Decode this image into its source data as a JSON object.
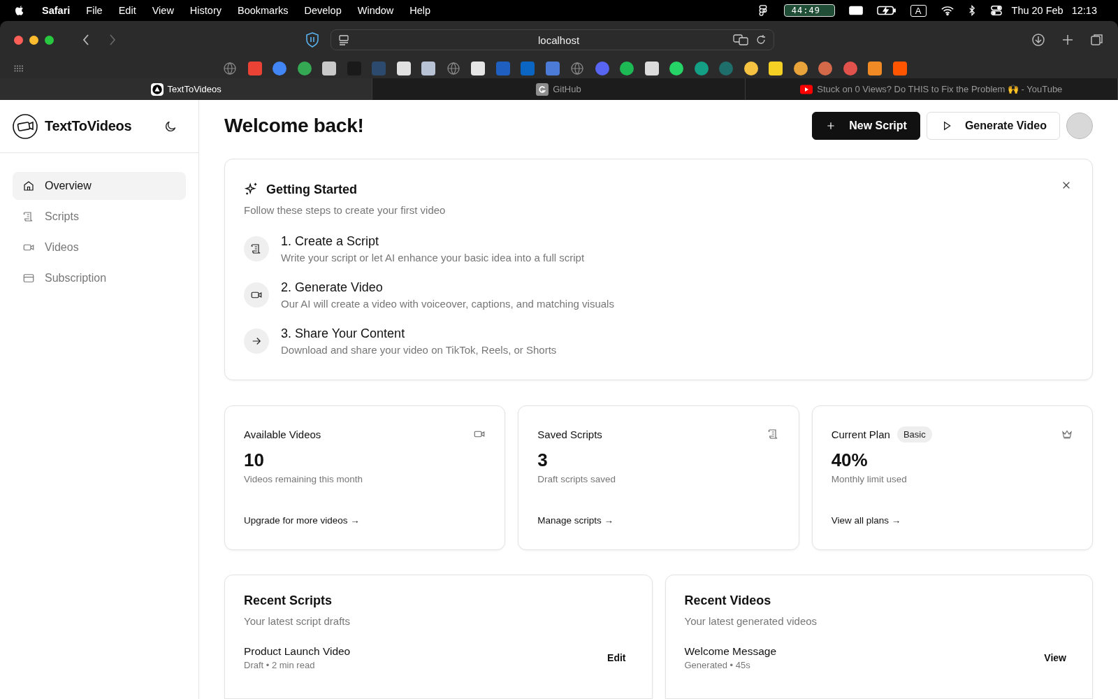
{
  "menu_bar": {
    "app": "Safari",
    "items": [
      "File",
      "Edit",
      "View",
      "History",
      "Bookmarks",
      "Develop",
      "Window",
      "Help"
    ],
    "timer": "44:49",
    "input_source": "A",
    "date": "Thu 20 Feb",
    "time": "12:13"
  },
  "browser": {
    "address": "localhost",
    "bookmarks": [
      {
        "kind": "globe",
        "color": "#8a8a8a"
      },
      {
        "kind": "tile",
        "color": "#ea4335"
      },
      {
        "kind": "round",
        "color": "#4285f4"
      },
      {
        "kind": "round",
        "color": "#34a853"
      },
      {
        "kind": "tile",
        "color": "#c9c9c9"
      },
      {
        "kind": "tile",
        "color": "#1a1a1a"
      },
      {
        "kind": "tile",
        "color": "#2c4a6e"
      },
      {
        "kind": "tile",
        "color": "#e0e0e0"
      },
      {
        "kind": "tile",
        "color": "#b9c3d6"
      },
      {
        "kind": "globe",
        "color": "#8a8a8a"
      },
      {
        "kind": "tile",
        "color": "#e6e6e6"
      },
      {
        "kind": "tile",
        "color": "#1f5fbf"
      },
      {
        "kind": "tile",
        "color": "#0a66c2"
      },
      {
        "kind": "tile",
        "color": "#4b7bd6"
      },
      {
        "kind": "globe",
        "color": "#8a8a8a"
      },
      {
        "kind": "round",
        "color": "#5865f2"
      },
      {
        "kind": "round",
        "color": "#1db954"
      },
      {
        "kind": "tile",
        "color": "#dcdcdc"
      },
      {
        "kind": "round",
        "color": "#25d366"
      },
      {
        "kind": "round",
        "color": "#14a085"
      },
      {
        "kind": "round",
        "color": "#1e6f6b"
      },
      {
        "kind": "round",
        "color": "#f5c242"
      },
      {
        "kind": "tile",
        "color": "#f5d024"
      },
      {
        "kind": "round",
        "color": "#e8a33b"
      },
      {
        "kind": "round",
        "color": "#d4694a"
      },
      {
        "kind": "round",
        "color": "#e0524b"
      },
      {
        "kind": "tile",
        "color": "#f08a24"
      },
      {
        "kind": "tile",
        "color": "#ff5500"
      }
    ],
    "tabs": [
      {
        "title": "TextToVideos",
        "selected": true,
        "kind": "app"
      },
      {
        "title": "GitHub",
        "selected": false,
        "kind": "letter"
      },
      {
        "title": "Stuck on 0 Views? Do THIS to Fix the Problem 🙌 - YouTube",
        "selected": false,
        "kind": "video"
      }
    ]
  },
  "sidebar": {
    "brand": "TextToVideos",
    "items": [
      {
        "label": "Overview",
        "kind": "home",
        "selected": true
      },
      {
        "label": "Scripts",
        "kind": "scroll",
        "selected": false
      },
      {
        "label": "Videos",
        "kind": "video",
        "selected": false
      },
      {
        "label": "Subscription",
        "kind": "card",
        "selected": false
      }
    ]
  },
  "header": {
    "title": "Welcome back!",
    "buttons": [
      {
        "label": "New Script",
        "kind": "primary"
      },
      {
        "label": "Generate Video",
        "kind": "outline"
      }
    ]
  },
  "getting_started": {
    "title": "Getting Started",
    "subtitle": "Follow these steps to create your first video",
    "steps": [
      {
        "title": "1. Create a Script",
        "description": "Write your script or let AI enhance your basic idea into a full script",
        "kind": "scroll"
      },
      {
        "title": "2. Generate Video",
        "description": "Our AI will create a video with voiceover, captions, and matching visuals",
        "kind": "video"
      },
      {
        "title": "3. Share Your Content",
        "description": "Download and share your video on TikTok, Reels, or Shorts",
        "kind": "arrow"
      }
    ]
  },
  "stats": [
    {
      "title": "Available Videos",
      "value": "10",
      "caption": "Videos remaining this month",
      "link": "Upgrade for more videos →",
      "kind": "video"
    },
    {
      "title": "Saved Scripts",
      "value": "3",
      "caption": "Draft scripts saved",
      "link": "Manage scripts →",
      "kind": "scroll"
    },
    {
      "title": "Current Plan",
      "badge": "Basic",
      "value": "40%",
      "caption": "Monthly limit used",
      "link": "View all plans →",
      "kind": "crown"
    }
  ],
  "recent": [
    {
      "title": "Recent Scripts",
      "subtitle": "Your latest script drafts",
      "items": [
        {
          "name": "Product Launch Video",
          "meta": "Draft • 2 min read",
          "action": "Edit"
        }
      ]
    },
    {
      "title": "Recent Videos",
      "subtitle": "Your latest generated videos",
      "items": [
        {
          "name": "Welcome Message",
          "meta": "Generated • 45s",
          "action": "View"
        }
      ]
    }
  ]
}
